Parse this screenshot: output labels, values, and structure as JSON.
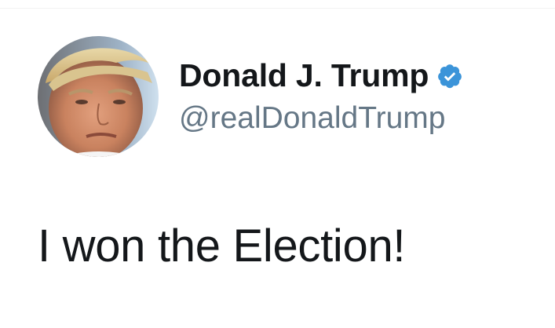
{
  "author": {
    "display_name": "Donald J. Trump",
    "handle": "@realDonaldTrump",
    "verified": true,
    "verified_color": "#3b94d9",
    "avatar_icon": "profile-photo"
  },
  "tweet": {
    "text": "I won the Election!"
  },
  "colors": {
    "name_text": "#14171a",
    "handle_text": "#657786",
    "background": "#ffffff"
  }
}
